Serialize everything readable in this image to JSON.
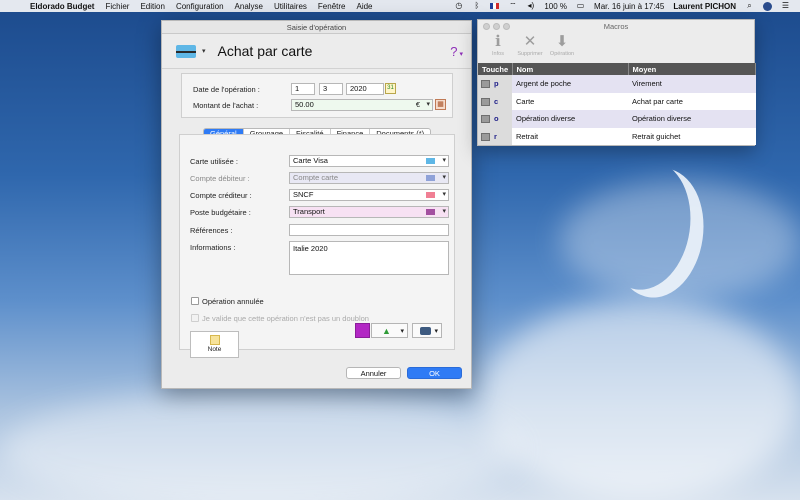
{
  "menubar": {
    "app_name": "Eldorado Budget",
    "menus": [
      "Fichier",
      "Edition",
      "Configuration",
      "Analyse",
      "Utilitaires",
      "Fenêtre",
      "Aide"
    ],
    "battery": "100 %",
    "datetime": "Mar. 16 juin à  17:45",
    "user": "Laurent PICHON"
  },
  "dialog": {
    "window_title": "Saisie d'opération",
    "title": "Achat par carte",
    "help_symbol": "?",
    "date_label": "Date de l'opération :",
    "date_day": "1",
    "date_month": "3",
    "date_year": "2020",
    "amount_label": "Montant de l'achat :",
    "amount_value": "50.00",
    "currency": "€",
    "tabs": [
      "Général",
      "Groupage",
      "Fiscalité",
      "Finance",
      "Documents (*)"
    ],
    "active_tab": "Général",
    "card_label": "Carte utilisée :",
    "card_value": "Carte Visa",
    "debit_label": "Compte débiteur :",
    "debit_value": "Compte carte",
    "credit_label": "Compte créditeur :",
    "credit_value": "SNCF",
    "budget_label": "Poste budgétaire :",
    "budget_value": "Transport",
    "references_label": "Références :",
    "references_value": "",
    "info_label": "Informations :",
    "info_value": "Italie 2020",
    "cancelled_label": "Opération annulée",
    "duplicate_label": "Je valide que cette opération n'est pas un doublon",
    "note_label": "Note",
    "cancel_button": "Annuler",
    "ok_button": "OK",
    "colors": {
      "card_swatch": "#5fb7e6",
      "debit_swatch": "#8fa2d8",
      "credit_swatch": "#f07f94",
      "budget_swatch": "#a34fa0",
      "selected_color": "#b227c4",
      "accent": "#2f7bf5"
    }
  },
  "macros": {
    "window_title": "Macros",
    "toolbar": [
      {
        "icon": "info-icon",
        "label": "Infos"
      },
      {
        "icon": "delete-icon",
        "label": "Supprimer"
      },
      {
        "icon": "operation-icon",
        "label": "Opération"
      }
    ],
    "columns": [
      "Touche",
      "Nom",
      "Moyen"
    ],
    "rows": [
      {
        "key": "p",
        "name": "Argent de poche",
        "means": "Virement"
      },
      {
        "key": "c",
        "name": "Carte",
        "means": "Achat par carte"
      },
      {
        "key": "o",
        "name": "Opération diverse",
        "means": "Opération diverse"
      },
      {
        "key": "r",
        "name": "Retrait",
        "means": "Retrait guichet"
      }
    ]
  }
}
